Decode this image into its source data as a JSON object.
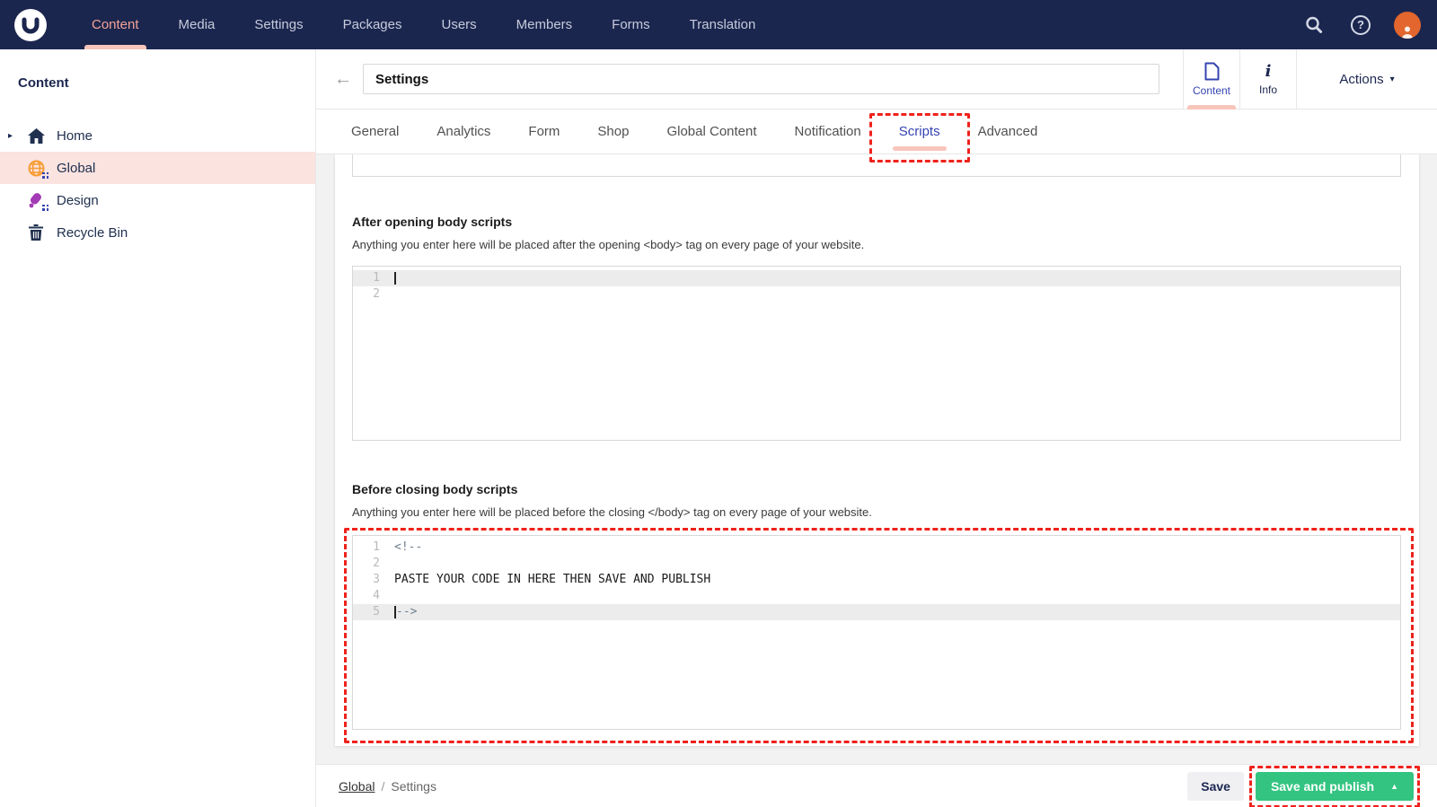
{
  "topnav": {
    "logo_letter": "U",
    "items": [
      {
        "label": "Content",
        "active": true
      },
      {
        "label": "Media",
        "active": false
      },
      {
        "label": "Settings",
        "active": false
      },
      {
        "label": "Packages",
        "active": false
      },
      {
        "label": "Users",
        "active": false
      },
      {
        "label": "Members",
        "active": false
      },
      {
        "label": "Forms",
        "active": false
      },
      {
        "label": "Translation",
        "active": false
      }
    ],
    "help_glyph": "?"
  },
  "sidebar": {
    "title": "Content",
    "items": [
      {
        "label": "Home",
        "icon": "home-icon",
        "selected": false,
        "expandable": true
      },
      {
        "label": "Global",
        "icon": "globe-icon",
        "selected": true
      },
      {
        "label": "Design",
        "icon": "design-icon",
        "selected": false
      },
      {
        "label": "Recycle Bin",
        "icon": "trash-icon",
        "selected": false
      }
    ]
  },
  "header": {
    "back_glyph": "←",
    "title_value": "Settings",
    "apps": [
      {
        "label": "Content",
        "icon": "document-icon",
        "active": true
      },
      {
        "label": "Info",
        "icon": "info-icon",
        "active": false
      }
    ],
    "actions_label": "Actions",
    "actions_caret": "▾"
  },
  "tabs": [
    {
      "label": "General",
      "active": false
    },
    {
      "label": "Analytics",
      "active": false
    },
    {
      "label": "Form",
      "active": false
    },
    {
      "label": "Shop",
      "active": false
    },
    {
      "label": "Global Content",
      "active": false
    },
    {
      "label": "Notification",
      "active": false
    },
    {
      "label": "Scripts",
      "active": true,
      "highlighted": true
    },
    {
      "label": "Advanced",
      "active": false
    }
  ],
  "sections": [
    {
      "heading": "After opening body scripts",
      "description": "Anything you enter here will be placed after the opening <body> tag on every page of your website.",
      "lines": [
        {
          "num": "1",
          "text": "",
          "active": true,
          "cursor": true
        },
        {
          "num": "2",
          "text": ""
        }
      ]
    },
    {
      "heading": "Before closing body scripts",
      "description": "Anything you enter here will be placed before the closing </body> tag on every page of your website.",
      "highlighted": true,
      "lines": [
        {
          "num": "1",
          "text": "<!--",
          "comment": true
        },
        {
          "num": "2",
          "text": ""
        },
        {
          "num": "3",
          "text": "PASTE YOUR CODE IN HERE THEN SAVE AND PUBLISH"
        },
        {
          "num": "4",
          "text": ""
        },
        {
          "num": "5",
          "text": "-->",
          "comment": true,
          "active": true,
          "cursor": true
        }
      ]
    }
  ],
  "footer": {
    "breadcrumb": [
      "Global",
      "Settings"
    ],
    "separator": "/",
    "save_label": "Save",
    "save_publish_label": "Save and publish",
    "publish_caret": "▲"
  },
  "colors": {
    "topnav_bg": "#1b264f",
    "accent_blue": "#3544b1",
    "active_salmon_text": "#f5a397",
    "active_underline_pink": "#f8c5bb",
    "selected_row_pink": "#fbe3e0",
    "publish_green": "#33c481",
    "highlight_red_dash": "#ee221b",
    "avatar_orange": "#e2662d",
    "comment_code": "#708090"
  }
}
